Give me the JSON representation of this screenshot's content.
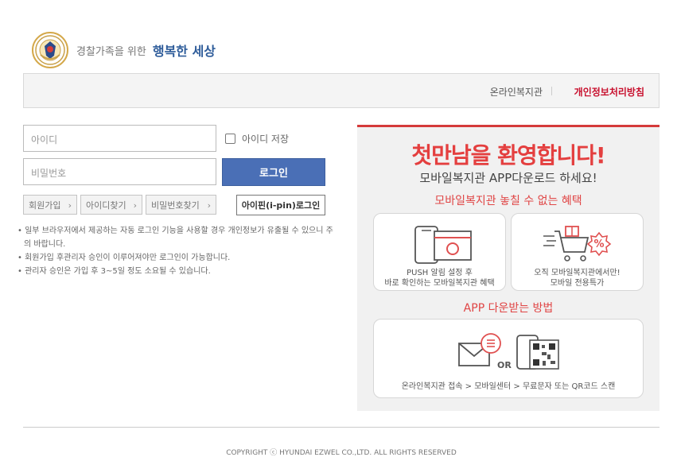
{
  "header": {
    "tagline": "경찰가족을 위한",
    "tagline_strong": "행복한 세상"
  },
  "topbar": {
    "online_label": "온라인복지관",
    "privacy_label": "개인정보처리방침"
  },
  "login": {
    "id_placeholder": "아이디",
    "pw_placeholder": "비밀번호",
    "remember_label": "아이디 저장",
    "remember_checked": false,
    "login_label": "로그인",
    "signup_label": "회원가입",
    "find_id_label": "아이디찾기",
    "find_pw_label": "비밀번호찾기",
    "ipin_label": "아이핀(i-pin)로그인"
  },
  "notices": [
    "일부 브라우저에서 제공하는 자동 로그인 기능을 사용할 경우 개인정보가 유출될 수 있으니 주의 바랍니다.",
    "회원가입 후관리자 승인이 이루어져야만 로그인이 가능합니다.",
    "관리자 승인은 가입 후 3~5일 정도 소요될 수 있습니다."
  ],
  "promo": {
    "title": "첫만남을 환영합니다!",
    "subtitle": "모바일복지관 APP다운로드 하세요!",
    "benefits_head": "모바일복지관 놓칠 수 없는 혜택",
    "card1_line1": "PUSH 알림 설정 후",
    "card1_line2": "바로 확인하는 모바일복지관 혜택",
    "card2_line1": "오직 모바일복지관에서만!",
    "card2_line2": "모바일 전용특가",
    "download_head": "APP 다운받는 방법",
    "or_label": "OR",
    "steps": "온라인복지관 접속 > 모바일센터 > 무료문자 또는 QR코드 스캔"
  },
  "footer": {
    "copyright": "COPYRIGHT ⓒ HYUNDAI EZWEL CO.,LTD. ALL RIGHTS RESERVED"
  },
  "colors": {
    "accent_red": "#e43f3f",
    "login_blue": "#4a6fb6",
    "brand_blue": "#2e5c9a"
  }
}
